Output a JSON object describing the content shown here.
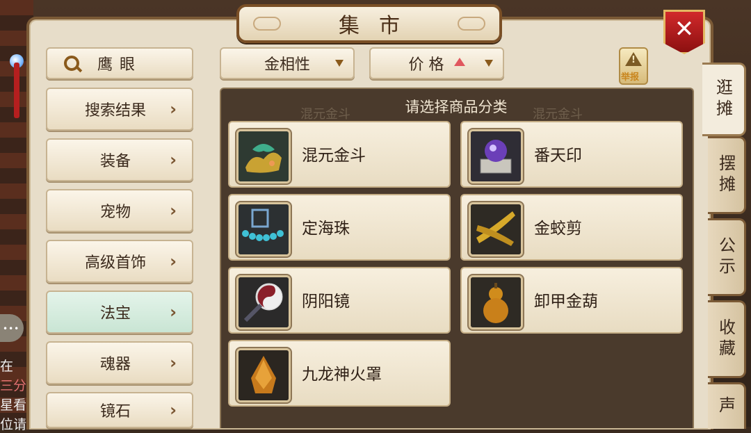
{
  "window": {
    "title": "集市",
    "close_label": "✕"
  },
  "left_nav": {
    "eagle_eye": "鹰眼",
    "items": [
      {
        "label": "搜索结果"
      },
      {
        "label": "装备"
      },
      {
        "label": "宠物"
      },
      {
        "label": "高级首饰"
      },
      {
        "label": "法宝",
        "active": true
      },
      {
        "label": "魂器"
      },
      {
        "label": "镜石"
      }
    ]
  },
  "filters": {
    "attribute": {
      "value": "金相性"
    },
    "price": {
      "label": "价 格",
      "sort": "ascending"
    },
    "report_label": "举报"
  },
  "content": {
    "prompt": "请选择商品分类",
    "ghost_text": [
      "混元金斗",
      "混元金斗"
    ],
    "items": [
      {
        "name": "混元金斗",
        "icon": "golden-dragon-bowl-icon"
      },
      {
        "name": "番天印",
        "icon": "purple-seal-icon"
      },
      {
        "name": "定海珠",
        "icon": "blue-bead-string-icon"
      },
      {
        "name": "金蛟剪",
        "icon": "golden-scissors-icon"
      },
      {
        "name": "阴阳镜",
        "icon": "yin-yang-mirror-icon"
      },
      {
        "name": "卸甲金葫",
        "icon": "golden-gourd-icon"
      },
      {
        "name": "九龙神火罩",
        "icon": "nine-dragon-cover-icon"
      }
    ]
  },
  "right_tabs": [
    {
      "label": "逛摊",
      "active": true
    },
    {
      "label": "摆摊"
    },
    {
      "label": "公示"
    },
    {
      "label": "收藏"
    },
    {
      "label": "声"
    }
  ],
  "background_chat": {
    "bubble": "•••",
    "lines": [
      "在",
      "三分",
      "星看",
      "位请"
    ]
  },
  "colors": {
    "accent": "#7b5a36",
    "price_up": "#e0575e",
    "close": "#c61f21",
    "active_cat": "#d5ecdf"
  }
}
